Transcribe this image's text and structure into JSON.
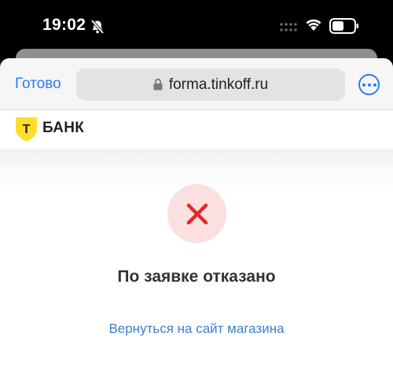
{
  "status_bar": {
    "time": "19:02"
  },
  "browser": {
    "done_label": "Готово",
    "url": "forma.tinkoff.ru"
  },
  "brand": {
    "logo_letter": "Т",
    "name": "БАНК",
    "logo_color": "#ffdd2d"
  },
  "result": {
    "title": "По заявке отказано",
    "link": "Вернуться на сайт магазина",
    "icon": "close-icon",
    "icon_color": "#e02a2a",
    "circle_color": "#fbe0e0"
  }
}
